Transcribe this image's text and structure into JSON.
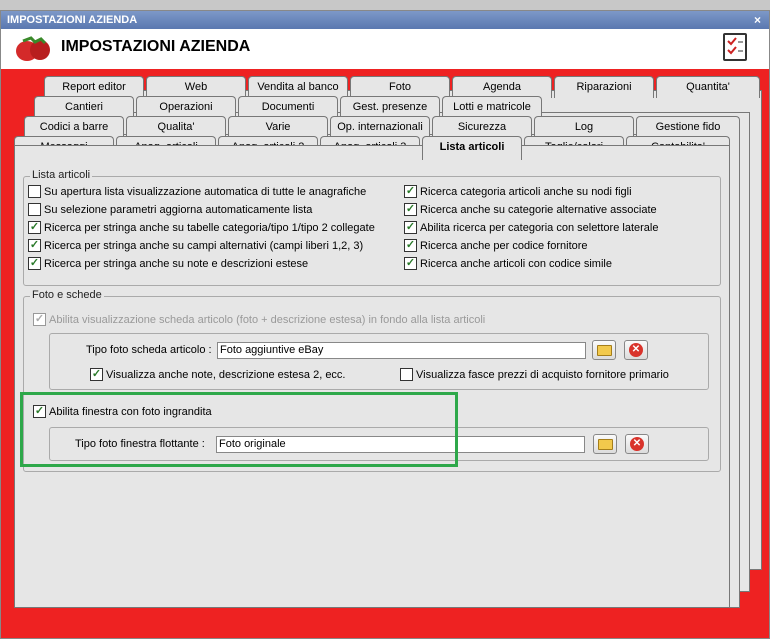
{
  "window": {
    "title": "IMPOSTAZIONI AZIENDA",
    "close_glyph": "×"
  },
  "header": {
    "title": "IMPOSTAZIONI AZIENDA",
    "logo_icon": "strawberry-icon",
    "check_icon": "checklist-icon"
  },
  "tabs": {
    "row1": [
      "Report editor",
      "Web",
      "Vendita al banco",
      "Foto",
      "Agenda",
      "Riparazioni",
      "Quantita'"
    ],
    "row2": [
      "Cantieri",
      "Operazioni",
      "Documenti",
      "Gest. presenze",
      "Lotti e matricole"
    ],
    "row3": [
      "Codici a barre",
      "Qualita'",
      "Varie",
      "Op. internazionali",
      "Sicurezza",
      "Log",
      "Gestione fido"
    ],
    "row4": [
      "Messaggi",
      "Anag. articoli",
      "Anag. articoli 2",
      "Anag. articoli 3",
      "Lista articoli",
      "Taglie/colori",
      "Contabilita'"
    ],
    "active": "Lista articoli"
  },
  "lista_articoli": {
    "legend": "Lista articoli",
    "left": [
      {
        "label": "Su apertura lista visualizzazione automatica di tutte le anagrafiche",
        "checked": false
      },
      {
        "label": "Su selezione parametri aggiorna automaticamente lista",
        "checked": false
      },
      {
        "label": "Ricerca per stringa anche su tabelle categoria/tipo 1/tipo 2 collegate",
        "checked": true
      },
      {
        "label": "Ricerca per stringa anche su campi alternativi (campi liberi 1,2, 3)",
        "checked": true
      },
      {
        "label": "Ricerca per stringa anche su note e descrizioni estese",
        "checked": true
      }
    ],
    "right": [
      {
        "label": "Ricerca categoria articoli anche su nodi figli",
        "checked": true
      },
      {
        "label": "Ricerca anche su categorie alternative associate",
        "checked": true
      },
      {
        "label": "Abilita ricerca per categoria con selettore laterale",
        "checked": true
      },
      {
        "label": "Ricerca anche per codice fornitore",
        "checked": true
      },
      {
        "label": "Ricerca anche articoli con codice simile",
        "checked": true
      }
    ]
  },
  "foto_schede": {
    "legend": "Foto e schede",
    "abilita_scheda": {
      "label": "Abilita visualizzazione scheda articolo (foto + descrizione estesa) in fondo alla lista articoli",
      "checked": true,
      "disabled": true
    },
    "tipo_foto_scheda": {
      "label": "Tipo foto scheda articolo :",
      "value": "Foto aggiuntive eBay"
    },
    "visualizza_note": {
      "label": "Visualizza anche note, descrizione estesa 2, ecc.",
      "checked": true
    },
    "visualizza_fasce": {
      "label": "Visualizza fasce prezzi di acquisto fornitore primario",
      "checked": false
    },
    "abilita_finestra": {
      "label": "Abilita finestra con foto ingrandita",
      "checked": true
    },
    "tipo_foto_finestra": {
      "label": "Tipo foto finestra flottante :",
      "value": "Foto originale"
    }
  },
  "colors": {
    "highlight": "#2ea84a",
    "window_bg": "#e22",
    "check": "#2a7a2a"
  },
  "check_glyph": "✓",
  "clear_glyph": "✕"
}
